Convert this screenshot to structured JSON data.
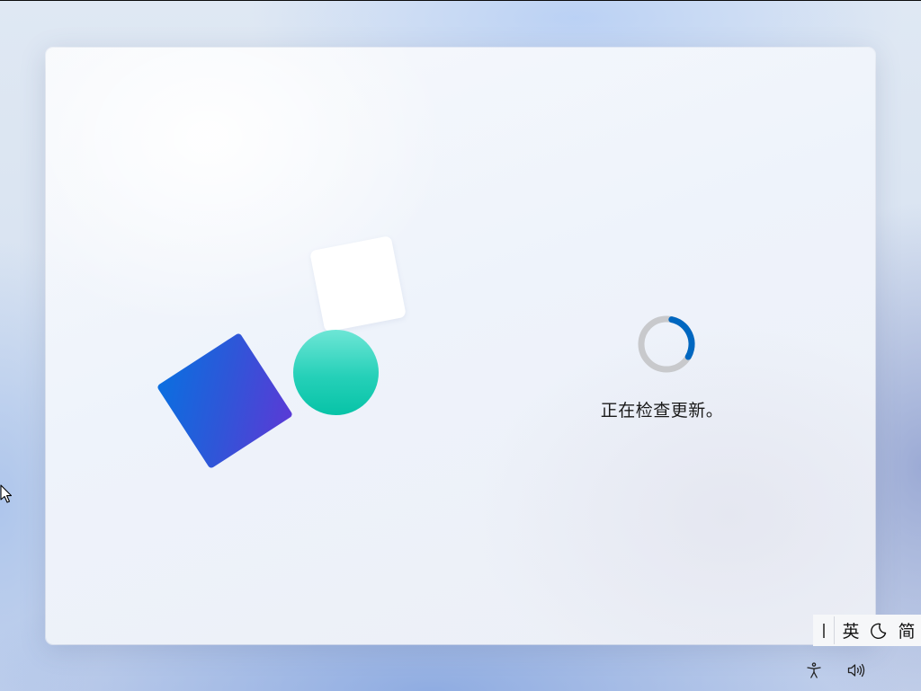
{
  "setup": {
    "status_text": "正在检查更新。",
    "spinner_progress": 0.3
  },
  "ime": {
    "language_label": "英",
    "mode_label": "简",
    "moon_icon": "moon-icon"
  },
  "tray": {
    "accessibility_icon": "accessibility-icon",
    "volume_icon": "volume-icon"
  },
  "colors": {
    "spinner_accent": "#0067c0",
    "spinner_track": "#c8c9cc",
    "blue_shape": "#2f56d8",
    "teal_shape": "#25d0b8"
  }
}
